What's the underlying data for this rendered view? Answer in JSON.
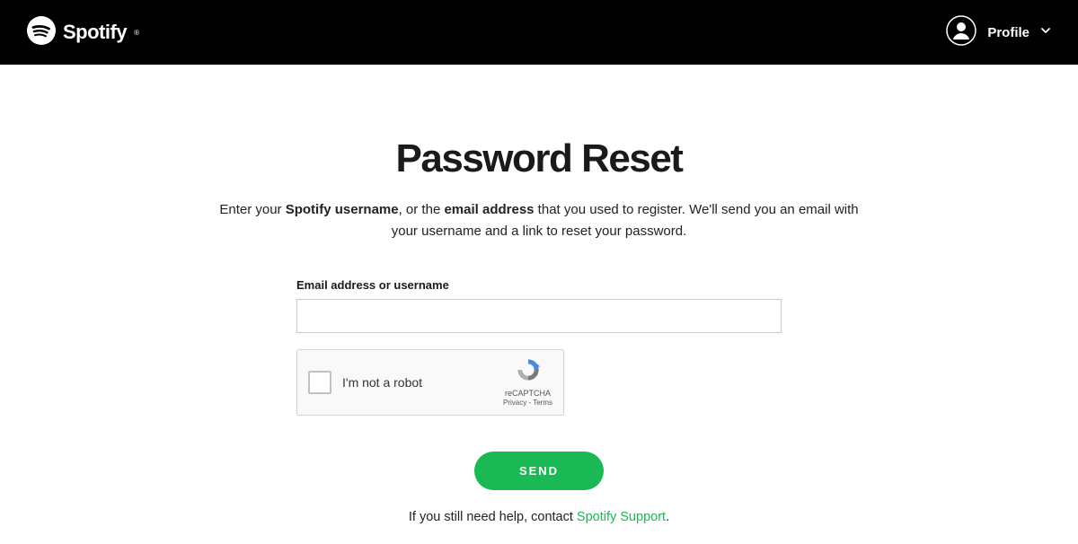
{
  "header": {
    "brand": "Spotify",
    "profile_label": "Profile"
  },
  "main": {
    "title": "Password Reset",
    "desc_pre": "Enter your ",
    "desc_bold1": "Spotify username",
    "desc_mid1": ", or the ",
    "desc_bold2": "email address",
    "desc_post": " that you used to register. We'll send you an email with your username and a link to reset your password.",
    "field_label": "Email address or username",
    "input_value": "",
    "recaptcha_label": "I'm not a robot",
    "recaptcha_name": "reCAPTCHA",
    "recaptcha_privacy": "Privacy",
    "recaptcha_terms": "Terms",
    "send_label": "SEND",
    "help_pre": "If you still need help, contact ",
    "help_link": "Spotify Support",
    "help_post": "."
  },
  "colors": {
    "accent": "#1ab954",
    "header_bg": "#000000"
  }
}
